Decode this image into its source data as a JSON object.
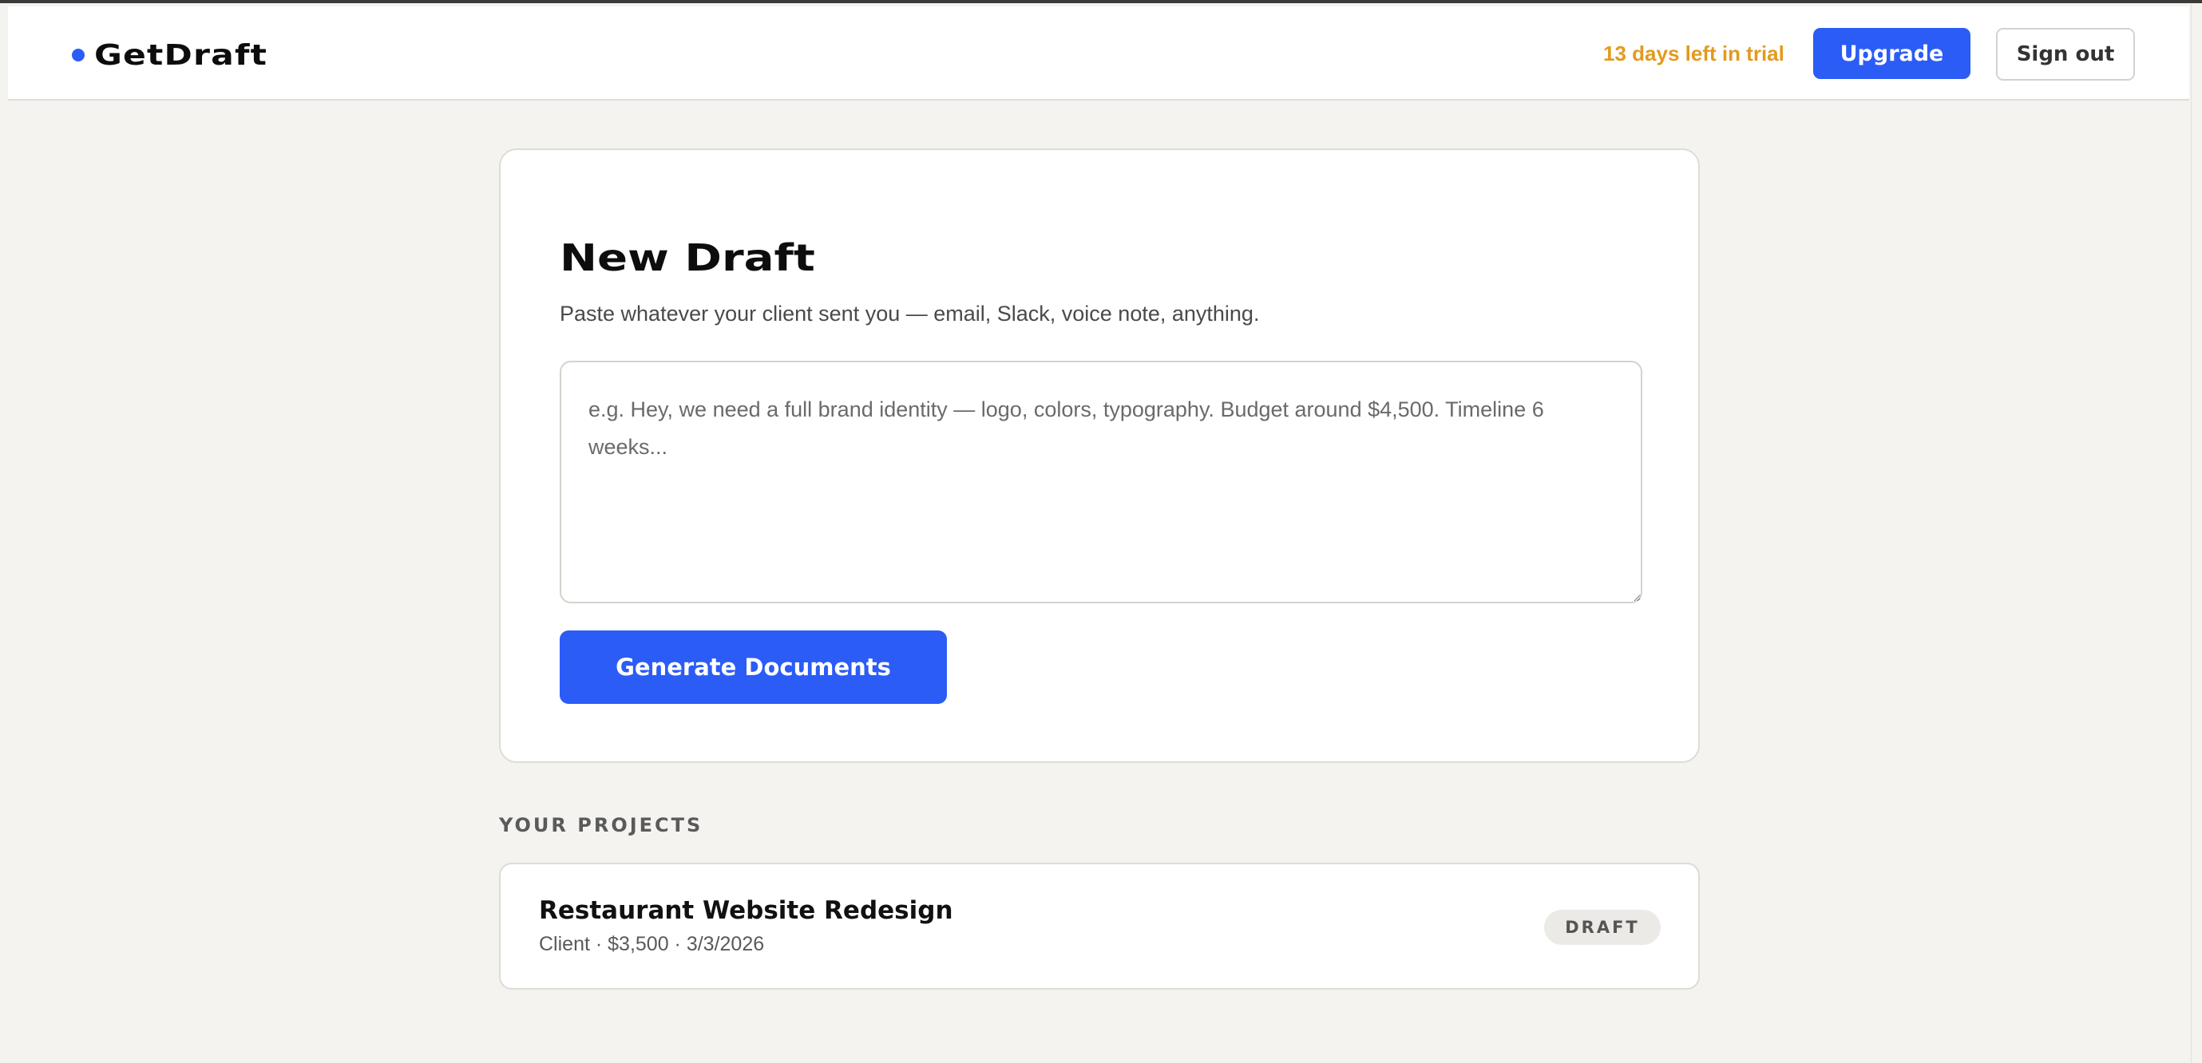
{
  "header": {
    "brand": "GetDraft",
    "trial_text": "13 days left in trial",
    "upgrade_label": "Upgrade",
    "signout_label": "Sign out"
  },
  "new_draft": {
    "title": "New Draft",
    "subtitle": "Paste whatever your client sent you — email, Slack, voice note, anything.",
    "input_value": "",
    "input_placeholder": "e.g. Hey, we need a full brand identity — logo, colors, typography. Budget around $4,500. Timeline 6 weeks...",
    "generate_label": "Generate Documents"
  },
  "projects": {
    "heading": "YOUR PROJECTS",
    "items": [
      {
        "name": "Restaurant Website Redesign",
        "meta": "Client · $3,500 · 3/3/2026",
        "status": "DRAFT"
      }
    ]
  },
  "colors": {
    "accent": "#2b5cf6",
    "trial": "#e39a1f",
    "background": "#f4f3ef"
  }
}
